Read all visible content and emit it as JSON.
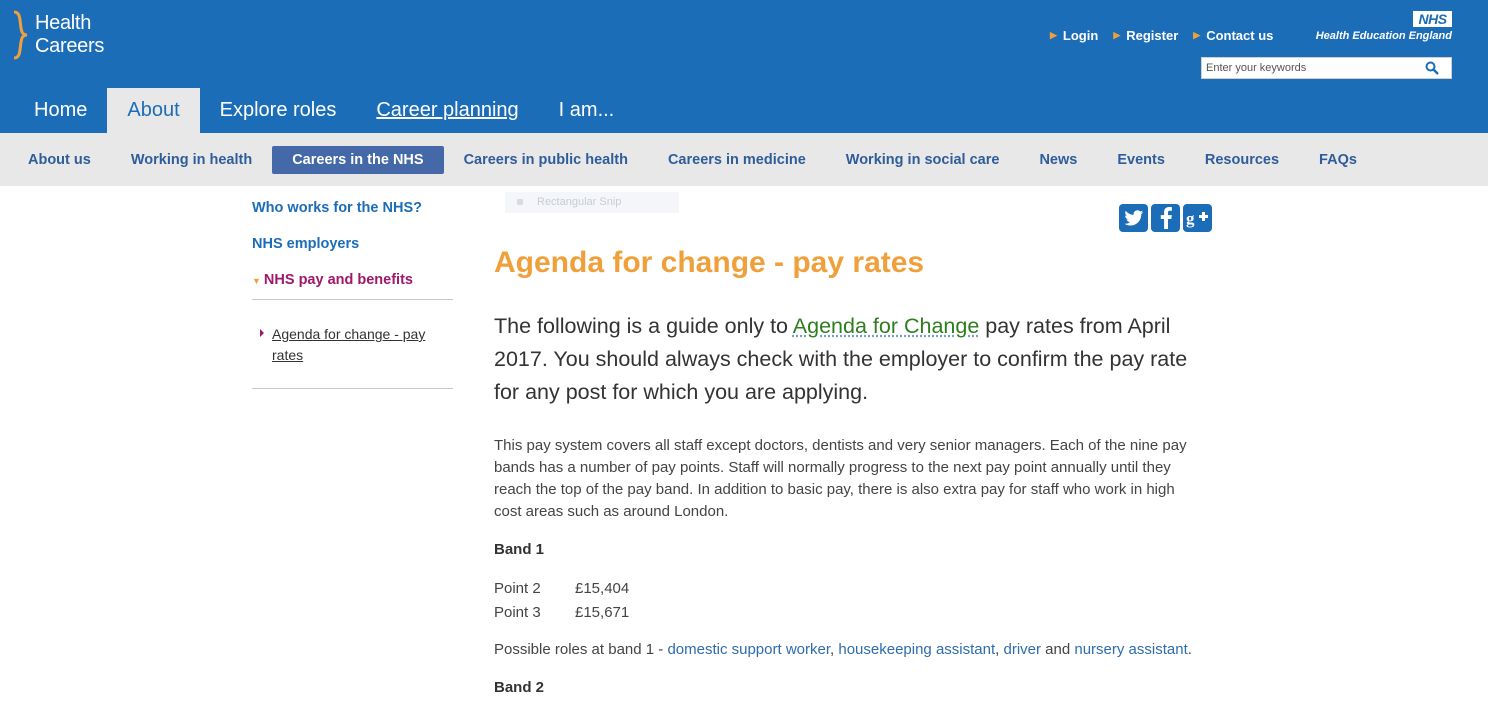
{
  "header": {
    "logo_line1": "Health",
    "logo_line2": "Careers",
    "util_links": [
      "Login",
      "Register",
      "Contact us"
    ],
    "nhs_badge": "NHS",
    "org_name": "Health Education England",
    "search_placeholder": "Enter your keywords",
    "main_tabs": [
      "Home",
      "About",
      "Explore roles",
      "Career planning",
      "I am..."
    ],
    "active_tab": "About"
  },
  "subnav": {
    "items": [
      "About us",
      "Working in health",
      "Careers in the NHS",
      "Careers in public health",
      "Careers in medicine",
      "Working in social care",
      "News",
      "Events",
      "Resources",
      "FAQs"
    ],
    "active": "Careers in the NHS"
  },
  "sidebar": {
    "links": [
      "Who works for the NHS?",
      "NHS employers"
    ],
    "current": "NHS pay and benefits",
    "sub_link": "Agenda for change - pay rates"
  },
  "snip_overlay": "Rectangular Snip",
  "social": [
    "twitter",
    "facebook",
    "google-plus"
  ],
  "content": {
    "title": "Agenda for change - pay rates",
    "intro_before": "The following is a guide only to ",
    "intro_link": "Agenda for Change",
    "intro_after": " pay rates from April 2017. You should always check with the employer to confirm the pay rate for any post for which you are applying.",
    "body": "This pay system covers all staff except doctors, dentists and very senior managers. Each of the nine pay bands has a number of pay points. Staff will normally progress to the next pay point annually until they reach the top of the pay band. In addition to basic pay, there is also extra pay for staff who work in high cost areas such as around London.",
    "band1_heading": "Band 1",
    "band1_points": [
      {
        "point": "Point 2",
        "amount": "£15,404"
      },
      {
        "point": "Point 3",
        "amount": "£15,671"
      }
    ],
    "roles_prefix": "Possible roles at band 1 - ",
    "roles_links": [
      "domestic support worker",
      "housekeeping assistant",
      "driver",
      "nursery assistant"
    ],
    "roles_sep1": ", ",
    "roles_sep2": ", ",
    "roles_and": " and ",
    "roles_end": ".",
    "band2_heading": "Band 2"
  },
  "colors": {
    "header_blue": "#1c6db8",
    "accent_orange": "#f0a03a",
    "active_subnav": "#4468a8",
    "current_magenta": "#a0176b",
    "link_green": "#2e7d1e"
  }
}
